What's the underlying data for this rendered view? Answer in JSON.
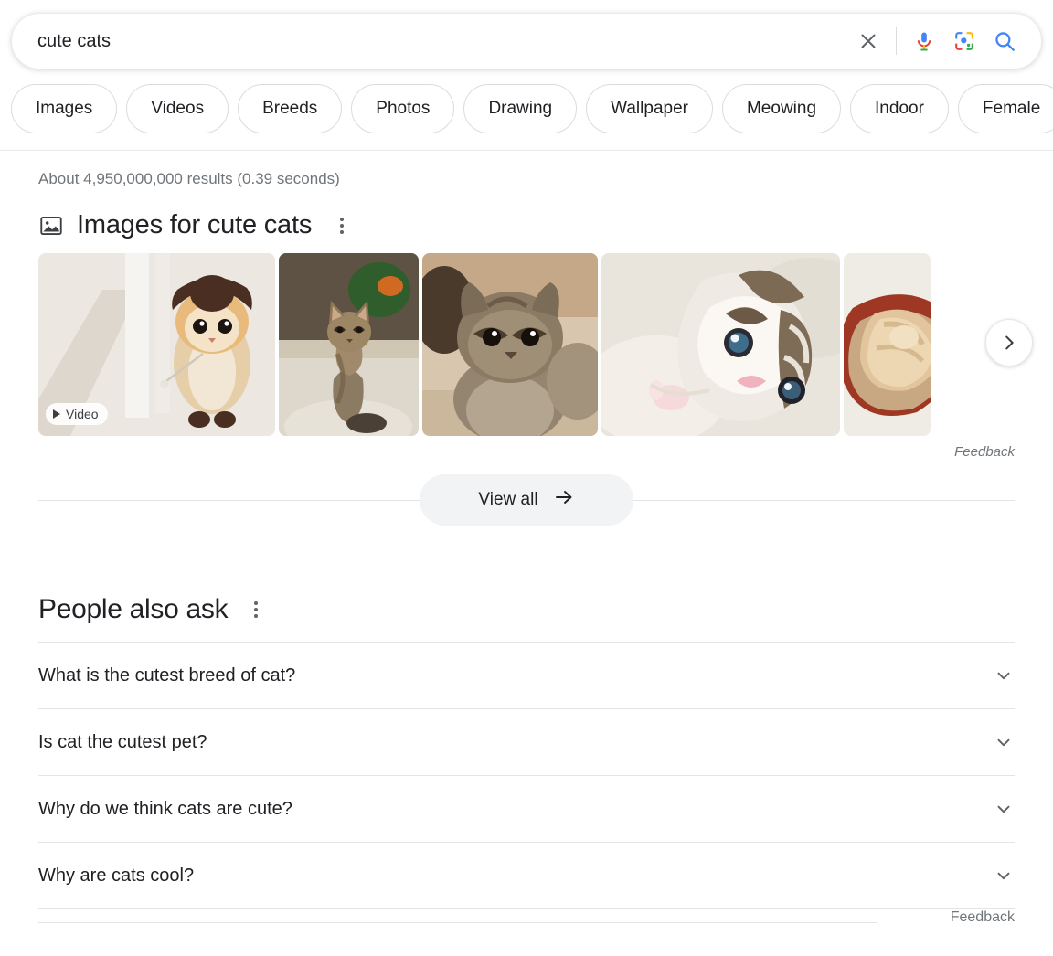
{
  "search": {
    "query": "cute cats",
    "placeholder": "Search",
    "clear_label": "Clear",
    "voice_label": "Search by voice",
    "lens_label": "Search by image",
    "submit_label": "Google Search",
    "icons": {
      "clear": "close-icon",
      "voice": "microphone-icon",
      "lens": "google-lens-icon",
      "search": "search-icon"
    }
  },
  "filter_chips": [
    {
      "label": "Images"
    },
    {
      "label": "Videos"
    },
    {
      "label": "Breeds"
    },
    {
      "label": "Photos"
    },
    {
      "label": "Drawing"
    },
    {
      "label": "Wallpaper"
    },
    {
      "label": "Meowing"
    },
    {
      "label": "Indoor"
    },
    {
      "label": "Female"
    }
  ],
  "results": {
    "count_text": "About 4,950,000,000 results (0.39 seconds)"
  },
  "images_block": {
    "icon": "picture-icon",
    "title": "Images for cute cats",
    "menu_icon": "more-options-icon",
    "thumbnails": [
      {
        "alt": "Crocheted orange kitten wearing a brown hat",
        "badge": "Video",
        "badge_icon": "play-icon"
      },
      {
        "alt": "Tabby kitten sitting on carpet",
        "badge": ""
      },
      {
        "alt": "Grey tabby kitten close up",
        "badge": ""
      },
      {
        "alt": "White and brown kitten lying down",
        "badge": ""
      },
      {
        "alt": "Ginger cat curled in a red bowl",
        "badge": ""
      }
    ],
    "next_icon": "chevron-right-icon",
    "next_label": "Next",
    "feedback_label": "Feedback"
  },
  "view_all": {
    "label": "View all",
    "icon": "arrow-right-icon"
  },
  "people_also_ask": {
    "title": "People also ask",
    "menu_icon": "more-options-icon",
    "questions": [
      {
        "text": "What is the cutest breed of cat?",
        "icon": "chevron-down-icon"
      },
      {
        "text": "Is cat the cutest pet?",
        "icon": "chevron-down-icon"
      },
      {
        "text": "Why do we think cats are cute?",
        "icon": "chevron-down-icon"
      },
      {
        "text": "Why are cats cool?",
        "icon": "chevron-down-icon"
      }
    ],
    "feedback_label": "Feedback"
  },
  "colors": {
    "google_blue": "#4285f4",
    "google_red": "#ea4335",
    "google_yellow": "#fbbc04",
    "google_green": "#34a853",
    "text_primary": "#202124",
    "text_secondary": "#70757a",
    "chip_border": "#dadce0"
  }
}
